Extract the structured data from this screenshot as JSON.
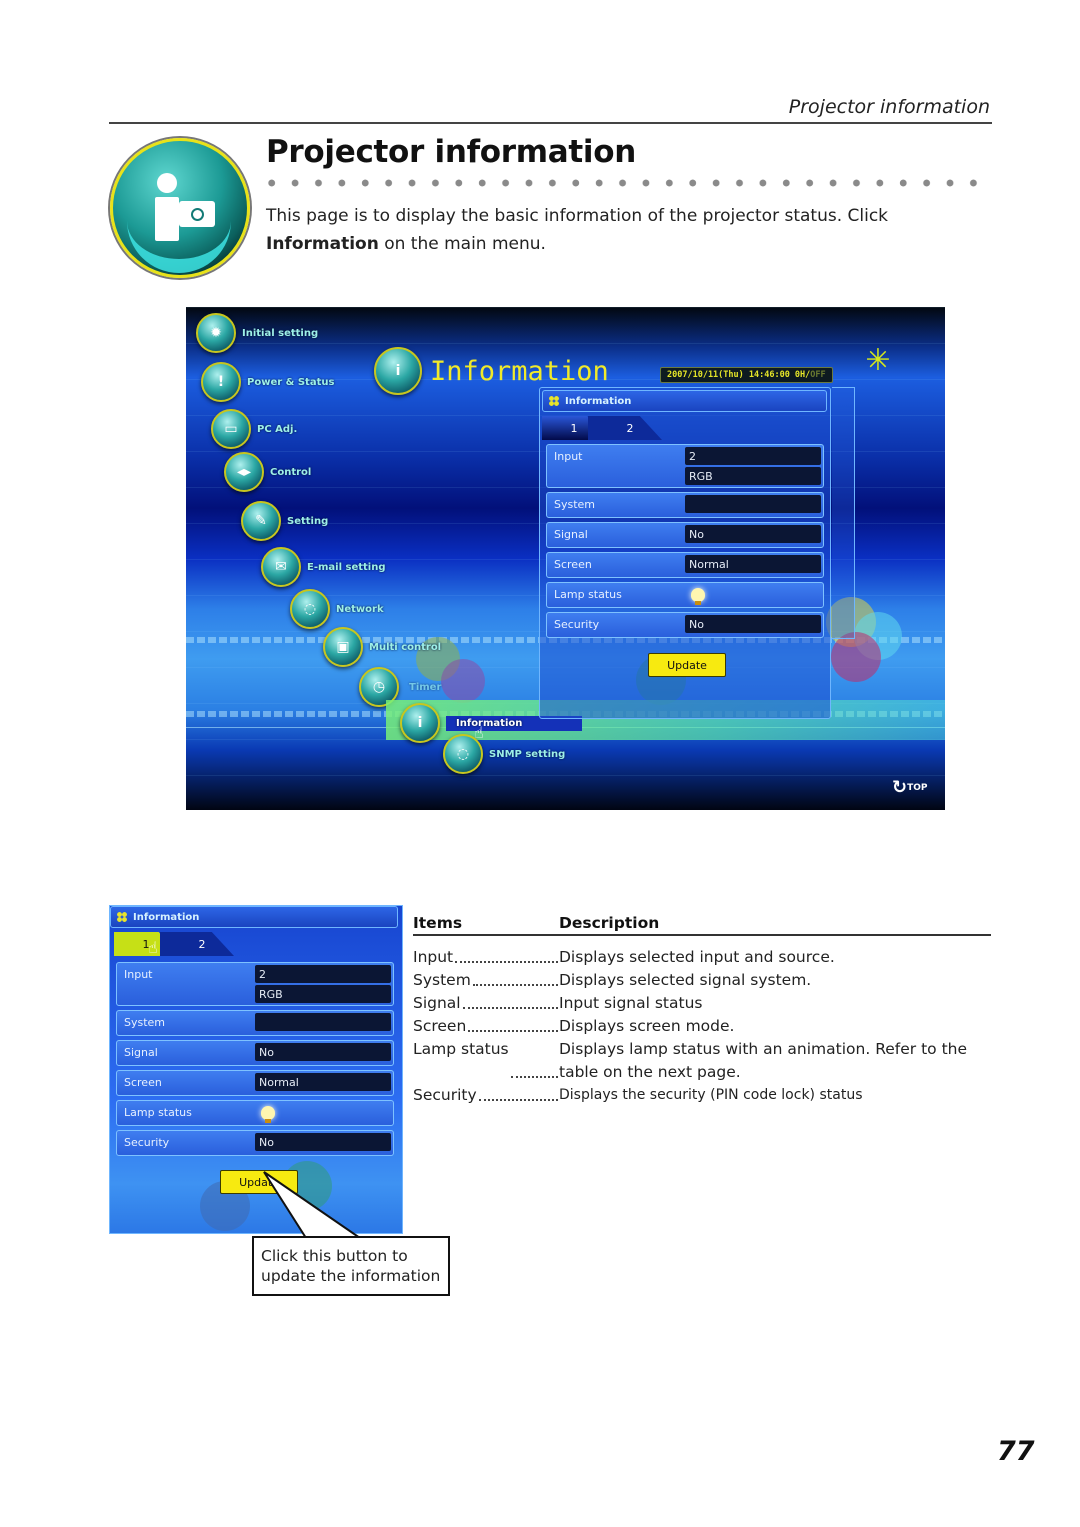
{
  "header": {
    "running_head": "Projector information",
    "title": "Projector information",
    "intro_before": "This page is to display the basic information of the projector status. Click ",
    "intro_bold": "Information",
    "intro_after": " on the main menu."
  },
  "screenshot": {
    "app_title": "Information",
    "datetime": "2007/10/11(Thu)  14:46:00  0H/",
    "datetime_off": "OFF",
    "menu": [
      {
        "label": "Initial setting",
        "icon": "sun-gear-icon"
      },
      {
        "label": "Power & Status",
        "icon": "projector-alert-icon"
      },
      {
        "label": "PC Adj.",
        "icon": "computer-icon"
      },
      {
        "label": "Control",
        "icon": "directional-pad-icon"
      },
      {
        "label": "Setting",
        "icon": "wrench-screwdriver-icon"
      },
      {
        "label": "E-mail setting",
        "icon": "envelope-icon"
      },
      {
        "label": "Network",
        "icon": "network-projector-icon"
      },
      {
        "label": "Multi control",
        "icon": "multi-projector-icon"
      },
      {
        "label": "Timer",
        "icon": "clock-icon"
      },
      {
        "label": "Information",
        "icon": "info-projector-icon",
        "active": true
      },
      {
        "label": "SNMP setting",
        "icon": "snmp-icon"
      }
    ],
    "panel_title": "Information",
    "tabs": [
      "1",
      "2"
    ],
    "rows": [
      {
        "label": "Input",
        "values": [
          "2",
          "RGB"
        ]
      },
      {
        "label": "System",
        "values": [
          ""
        ]
      },
      {
        "label": "Signal",
        "values": [
          "No"
        ]
      },
      {
        "label": "Screen",
        "values": [
          "Normal"
        ]
      },
      {
        "label": "Lamp status",
        "lamp": true
      },
      {
        "label": "Security",
        "values": [
          "No"
        ]
      }
    ],
    "update_label": "Update",
    "top_label": "TOP"
  },
  "callout": {
    "line1": "Click this button to",
    "line2": "update the information"
  },
  "description_table": {
    "headers": [
      "Items",
      "Description"
    ],
    "rows": [
      {
        "item": "Input",
        "text": "Displays selected input and source."
      },
      {
        "item": "System",
        "text": "Displays selected signal system."
      },
      {
        "item": "Signal",
        "text": "Input signal status"
      },
      {
        "item": "Screen",
        "text": "Displays screen mode."
      },
      {
        "item": "Lamp status",
        "text": "Displays lamp status with an animation. Refer to the",
        "text2": "table on the next page."
      },
      {
        "item": "Security",
        "text": "Displays the security (PIN code lock) status"
      }
    ]
  },
  "page_number": "77",
  "colors": {
    "accent_yellow": "#f7ea10",
    "screen_blue": "#1c5ee0",
    "title_yellow": "#f0ea2a"
  }
}
